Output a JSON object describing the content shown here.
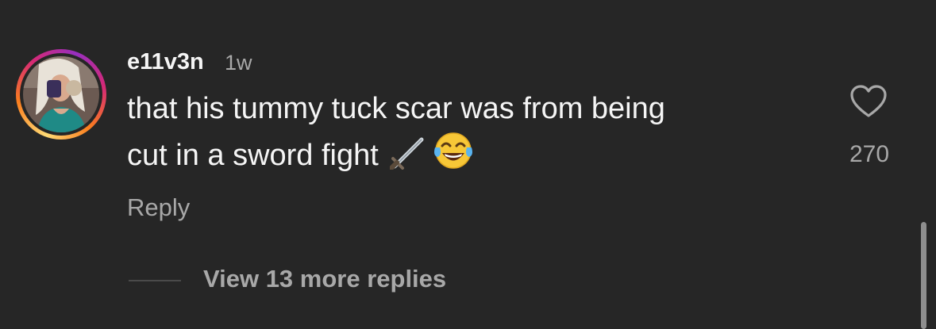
{
  "comment": {
    "username": "e11v3n",
    "timestamp": "1w",
    "text_line1": "that his tummy tuck scar was from being",
    "text_line2": "cut in a sword fight",
    "emojis": [
      "dagger-icon",
      "face-with-tears-of-joy-icon"
    ],
    "reply_label": "Reply",
    "like_count": "270",
    "view_replies_label": "View 13 more replies"
  },
  "colors": {
    "background": "#262626",
    "primary_text": "#f5f5f5",
    "secondary_text": "#a8a8a8",
    "story_ring": [
      "#feda75",
      "#fa7e1e",
      "#d62976",
      "#962fbf"
    ]
  }
}
